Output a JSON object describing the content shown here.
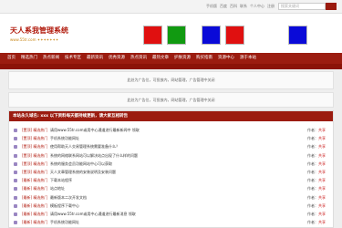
{
  "top_links": [
    "手机版",
    "百度",
    "百科",
    "联系",
    "个人中心",
    "注册"
  ],
  "search": {
    "placeholder": "搜索关键词"
  },
  "logo": {
    "title": "天人系我管理系统",
    "subtitle": "www.55tr.com  ✦✦✦✦✦✦✦"
  },
  "header_squares": [
    {
      "color": "#e01010"
    },
    {
      "color": "#119a11"
    },
    {
      "color": "#0a0ad8"
    },
    {
      "color": "#e01010"
    },
    {
      "color": "#0a0ad8"
    },
    {
      "color": "#119a11"
    }
  ],
  "nav": [
    "首页",
    "精选热门",
    "热点新闻",
    "技术专区",
    "最新资讯",
    "优秀资源",
    "热点资讯",
    "最热文章",
    "护肤资源",
    "购买指南",
    "资源中心",
    "源于本站"
  ],
  "ads": [
    "此处为广告位，可投放内，网站管理，广告管理中关闭",
    "此处为广告位，可投放内，网站管理，广告管理中关闭"
  ],
  "panel": {
    "heading": "本站永久域名: xxx 以下资料每天都持续更新，请大家互相转告",
    "rows": [
      {
        "category": "[置顶] 精选热门",
        "title": "请用www.55tr.com或用中心通道进行最新新闻中 领取",
        "author": "作者：",
        "author_name": "共享"
      },
      {
        "category": "[置顶] 精选热门",
        "title": "手机系统功能网址",
        "author": "作者：",
        "author_name": "共享"
      },
      {
        "category": "[置顶] 精选热门",
        "title": "使用帮助天人交易管理系统需要准备什么？",
        "author": "作者：",
        "author_name": "共享"
      },
      {
        "category": "[置顶] 精选热门",
        "title": "系统的网络联系网站可以解决站点出现了什么样的问题",
        "author": "作者：",
        "author_name": "共享"
      },
      {
        "category": "[置顶] 精选热门",
        "title": "系统的服务会员功能网站中心可以获取",
        "author": "作者：",
        "author_name": "共享"
      },
      {
        "category": "[置顶] 精选热门",
        "title": "天人文章管理系统的安装说明及安装问题",
        "author": "作者：",
        "author_name": "共享"
      },
      {
        "category": "[最新] 精选热门",
        "title": "下载本站程序",
        "author": "作者：",
        "author_name": "共享"
      },
      {
        "category": "[最新] 精选热门",
        "title": "站点地址",
        "author": "作者：",
        "author_name": "共享"
      },
      {
        "category": "[最新] 精选热门",
        "title": "最新版本二次开发文档",
        "author": "作者：",
        "author_name": "共享"
      },
      {
        "category": "[最新] 精选热门",
        "title": "模板程序下载中心",
        "author": "作者：",
        "author_name": "共享"
      },
      {
        "category": "[最新] 精选热门",
        "title": "请用www.55tr.com或用中心通道进行最新消息 领取",
        "author": "作者：",
        "author_name": "共享"
      },
      {
        "category": "[最新] 精选热门",
        "title": "手机系统功能网址",
        "author": "作者：",
        "author_name": "共享"
      }
    ]
  }
}
